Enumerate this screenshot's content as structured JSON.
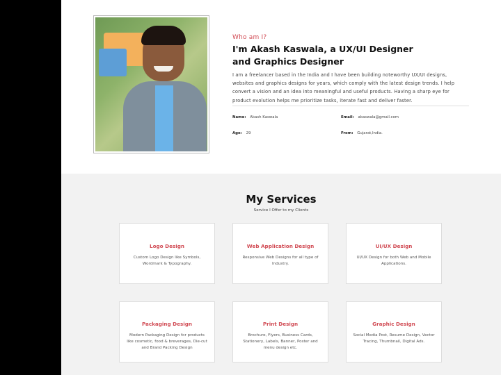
{
  "about": {
    "eyebrow": "Who am I?",
    "headline": "I'm Akash Kaswala, a UX/UI Designer and Graphics Designer",
    "bio": "I am a freelancer based in the India and I have been building  noteworthy UX/UI designs, websites and graphics designs for years, which comply with the  latest design trends. I help convert a vision and an idea into  meaningful and useful products. Having a sharp eye for product evolution  helps me prioritize tasks, iterate fast and deliver faster.",
    "info": [
      {
        "label": "Name:",
        "value": "Akash Kaswala"
      },
      {
        "label": "Email:",
        "value": "akaswala@gmail.com"
      },
      {
        "label": "Age:",
        "value": "29"
      },
      {
        "label": "From:",
        "value": "Gujarat,India."
      }
    ]
  },
  "services": {
    "title": "My Services",
    "subtitle": "Service I Offer to my Clients",
    "cards": [
      {
        "title": "Logo Design",
        "desc": "Custom Logo Design like Symbols, Wordmark & Typography."
      },
      {
        "title": "Web Application Design",
        "desc": "Responsive Web Designs for all type of Industry."
      },
      {
        "title": "UI/UX Design",
        "desc": "UI/UX Design for both Web and Mobile Applications."
      },
      {
        "title": "Packaging Design",
        "desc": "Modern Packaging Design for products like cosmetic, food & breverages, Die-cut and Brand Packing Design"
      },
      {
        "title": "Print Design",
        "desc": "Brochure, Flyers, Business Cards, Stationery, Labels, Banner, Poster and menu design etc."
      },
      {
        "title": "Graphic Design",
        "desc": "Social Media Post, Resume Design, Vector Tracing, Thumbnail, Digital Ads."
      }
    ]
  },
  "colors": {
    "accent": "#d14b54",
    "section_bg": "#f2f2f2",
    "sidebar": "#000000"
  }
}
